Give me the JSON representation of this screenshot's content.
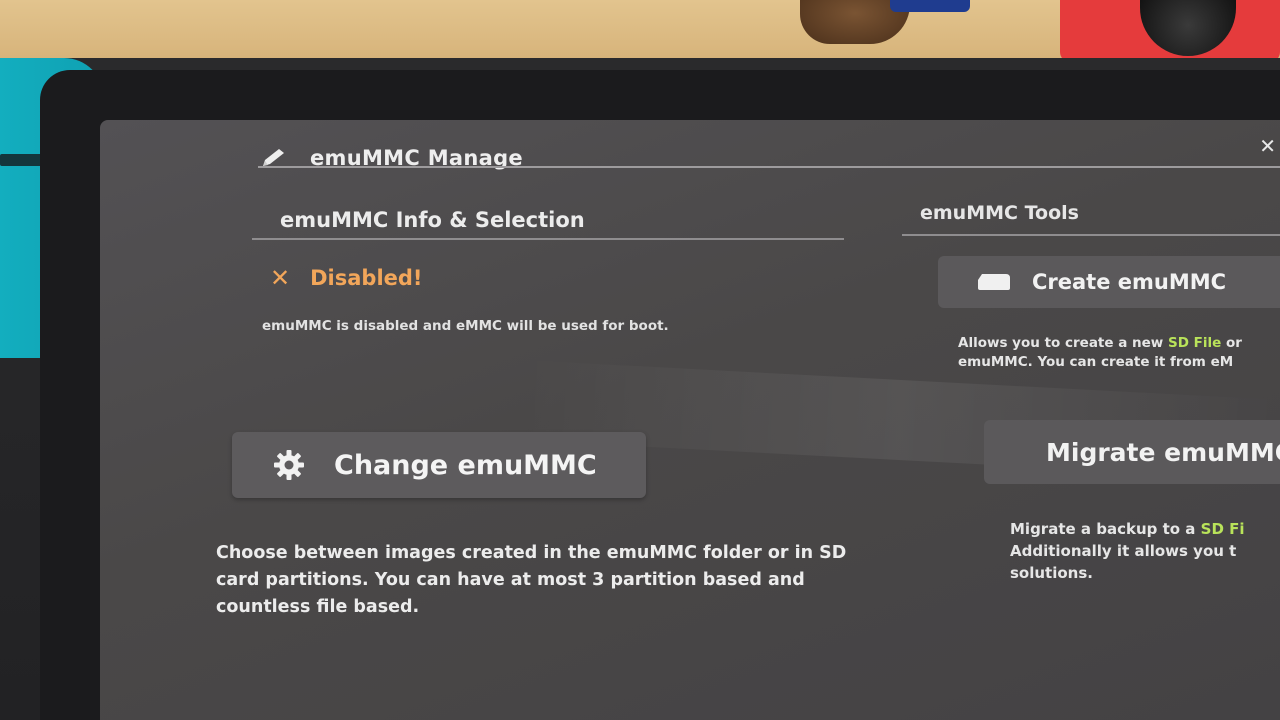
{
  "header": {
    "title": "emuMMC Manage",
    "icon": "pencil-icon",
    "back_icon": "back-icon"
  },
  "info_section": {
    "title": "emuMMC Info & Selection",
    "status": {
      "icon": "x-icon",
      "label": "Disabled!",
      "color": "#f2a65a"
    },
    "status_description": "emuMMC is disabled and eMMC will be used for boot.",
    "change_button": {
      "label": "Change emuMMC",
      "icon": "gear-icon"
    },
    "change_description": "Choose between images created in the emuMMC folder or in SD card partitions. You can have at most 3 partition based and countless file based."
  },
  "tools_section": {
    "title": "emuMMC Tools",
    "create_button": {
      "label": "Create emuMMC",
      "icon": "sdcard-icon"
    },
    "create_description": {
      "line1_before": "Allows you to create a new ",
      "line1_highlight": "SD File",
      "line1_after": " or",
      "line2": "emuMMC. You can create it from eM"
    },
    "migrate_button": {
      "label": "Migrate emuMMC",
      "icon": "migrate-icon"
    },
    "migrate_description": {
      "line1_before": "Migrate a backup to a ",
      "line1_highlight": "SD Fi",
      "line2": "Additionally it allows you t",
      "line3": "solutions."
    }
  },
  "colors": {
    "screen_bg": "#4a4848",
    "highlight": "#b9e35a",
    "warning": "#f2a65a"
  }
}
